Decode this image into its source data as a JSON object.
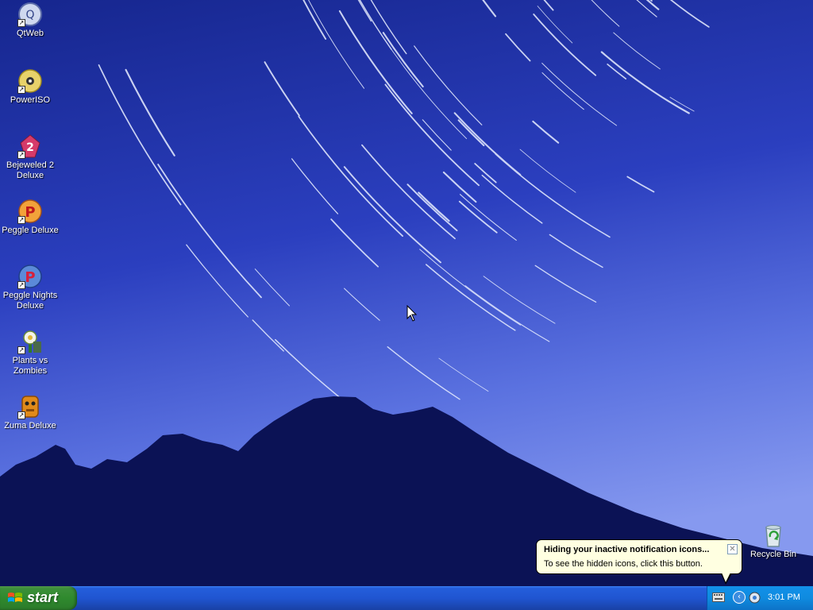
{
  "desktop": {
    "icons": [
      {
        "label": "QtWeb",
        "icon": "qtweb-globe-icon"
      },
      {
        "label": "PowerISO",
        "icon": "poweriso-disc-icon"
      },
      {
        "label": "Bejeweled 2 Deluxe",
        "icon": "bejeweled-icon"
      },
      {
        "label": "Peggle Deluxe",
        "icon": "peggle-icon"
      },
      {
        "label": "Peggle Nights Deluxe",
        "icon": "peggle-nights-icon"
      },
      {
        "label": "Plants vs Zombies",
        "icon": "plants-vs-zombies-icon"
      },
      {
        "label": "Zuma Deluxe",
        "icon": "zuma-icon"
      }
    ],
    "recycle_bin": {
      "label": "Recycle Bin",
      "icon": "recycle-bin-icon"
    }
  },
  "notification_balloon": {
    "title": "Hiding your inactive notification icons...",
    "message": "To see the hidden icons, click this button.",
    "close_glyph": "✕"
  },
  "taskbar": {
    "start_label": "start",
    "tray": {
      "expand_glyph": "‹",
      "time": "3:01 PM"
    }
  },
  "colors": {
    "sky_top": "#1a2a9c",
    "sky_bottom": "#6f86ea",
    "mountain": "#0c1357",
    "taskbar": "#245edb",
    "start_green": "#3c8f3a",
    "tray_blue": "#0f8bdf"
  }
}
